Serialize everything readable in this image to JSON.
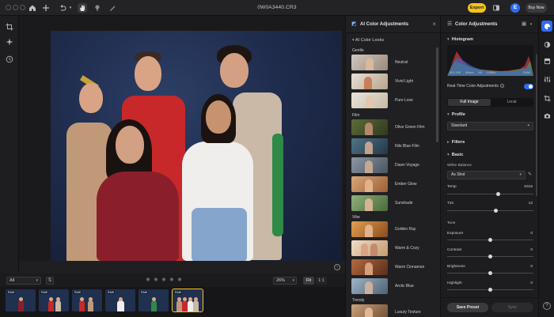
{
  "window": {
    "title": "0W0A3440.CR3"
  },
  "topbar": {
    "export_label": "Export",
    "avatar_initial": "E",
    "buy_label": "Buy Now"
  },
  "filmstrip_toolbar": {
    "filter_value": "All",
    "rating_stars": [
      "★",
      "★",
      "★",
      "★",
      "★"
    ],
    "zoom_value": "26%",
    "fit_label": "Fit",
    "one_to_one_label": "1:1"
  },
  "filmstrip": {
    "thumbs": [
      {
        "tag": "RAW",
        "selected": false
      },
      {
        "tag": "RAW",
        "selected": false
      },
      {
        "tag": "RAW",
        "selected": false
      },
      {
        "tag": "RAW",
        "selected": false
      },
      {
        "tag": "RAW",
        "selected": false
      },
      {
        "tag": "RAW",
        "selected": true
      }
    ]
  },
  "ai_panel": {
    "title": "AI Color Adjustments",
    "section": "AI Color Looks",
    "groups": [
      {
        "name": "Gentle",
        "looks": [
          "Neutral",
          "Vivid Light",
          "Pure Love"
        ]
      },
      {
        "name": "Film",
        "looks": [
          "Olive Green Film",
          "Nile Blue Film",
          "Dawn Voyage",
          "Ember Glow",
          "Sunshade"
        ]
      },
      {
        "name": "Vibe",
        "looks": [
          "Golden Ray",
          "Warm & Cozy",
          "Warm Cinnamon",
          "Arctic Blue"
        ]
      },
      {
        "name": "Trendy",
        "looks": [
          "Luxury Texture"
        ]
      }
    ]
  },
  "color_panel": {
    "title": "Color Adjustments",
    "histogram": {
      "label": "Histogram",
      "iso": "ISO 100",
      "focal": "50mm",
      "aperture": "f/8",
      "shutter": "1/160s",
      "tag": "RAW"
    },
    "realtime_label": "Real-Time Color Adjustments",
    "realtime_on": true,
    "scope_tabs": [
      "Full Image",
      "Local"
    ],
    "profile": {
      "label": "Profile",
      "value": "Standard"
    },
    "filters_label": "Filters",
    "basic": {
      "label": "Basic",
      "white_balance_label": "White Balance",
      "white_balance_value": "As Shot",
      "temp": {
        "label": "Temp",
        "value": "5316"
      },
      "tint": {
        "label": "Tint",
        "value": "12"
      }
    },
    "tone": {
      "label": "Tone",
      "sliders": [
        {
          "label": "Exposure",
          "value": 0
        },
        {
          "label": "Contrast",
          "value": 0
        },
        {
          "label": "Brightness",
          "value": 0
        },
        {
          "label": "Highlight",
          "value": 0
        }
      ]
    },
    "save_preset_label": "Save Preset",
    "sync_label": "Sync"
  },
  "colors": {
    "accent_yellow": "#f5c518",
    "accent_blue": "#2f6cf0",
    "backdrop_blue": "#1f2c4d"
  },
  "icons": {
    "left_tools": [
      "crop-icon",
      "sparkle-icon",
      "history-icon"
    ],
    "right_rail": [
      "palette-icon",
      "adjust-icon",
      "layers-icon",
      "sliders-icon",
      "crop-rail-icon",
      "camera-icon",
      "help-icon"
    ]
  }
}
